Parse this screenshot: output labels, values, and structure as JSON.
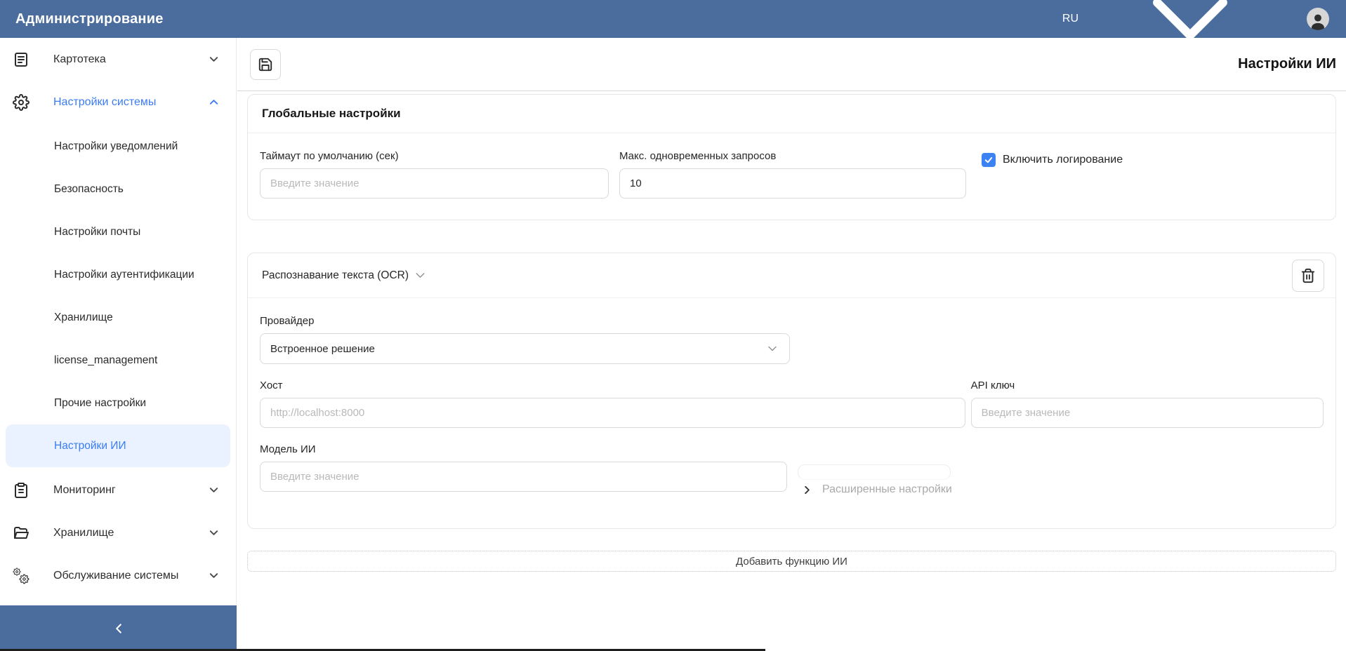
{
  "colors": {
    "topbar_bg": "#4a6d9e",
    "accent": "#3b7cf6",
    "active_bg": "#e9f2fe",
    "checkbox": "#3b82f6",
    "border": "#d9d9d9"
  },
  "topbar": {
    "title": "Администрирование",
    "language": "RU"
  },
  "icons": {
    "save": "floppy-disk",
    "delete": "trash-can",
    "language_chevron": "chevron-down",
    "collapse": "chevron-left",
    "cardfile": "document-lines",
    "system_settings": "gear",
    "monitoring": "clipboard",
    "storage": "folder",
    "maintenance": "double-gear",
    "user": "person-silhouette"
  },
  "sidebar": {
    "items": [
      {
        "label": "Картотека",
        "chevron": "down"
      },
      {
        "label": "Настройки системы",
        "chevron": "up",
        "active": true
      },
      {
        "label": "Мониторинг",
        "chevron": "down"
      },
      {
        "label": "Хранилище",
        "chevron": "down"
      },
      {
        "label": "Обслуживание системы",
        "chevron": "down"
      }
    ],
    "system_subitems": [
      "Настройки уведомлений",
      "Безопасность",
      "Настройки почты",
      "Настройки аутентификации",
      "Хранилище",
      "license_management",
      "Прочие настройки",
      "Настройки ИИ"
    ],
    "selected_subitem": "Настройки ИИ"
  },
  "page": {
    "title": "Настройки ИИ"
  },
  "global_settings": {
    "title": "Глобальные настройки",
    "fields": [
      {
        "label": "Таймаут по умолчанию (сек)",
        "placeholder": "Введите значение",
        "value": ""
      },
      {
        "label": "Макс. одновременных запросов",
        "value": "10"
      }
    ],
    "checkbox": {
      "label": "Включить логирование",
      "checked": true
    }
  },
  "ocr_card": {
    "title": "Распознавание текста (OCR)",
    "provider_label": "Провайдер",
    "provider_value": "Встроенное решение",
    "host_label": "Хост",
    "host_placeholder": "http://localhost:8000",
    "api_key_label": "API ключ",
    "api_key_placeholder": "Введите значение",
    "model_label": "Модель ИИ",
    "model_placeholder": "Введите значение",
    "advanced_label": "Расширенные настройки"
  },
  "add_button": {
    "label": "Добавить функцию ИИ"
  }
}
